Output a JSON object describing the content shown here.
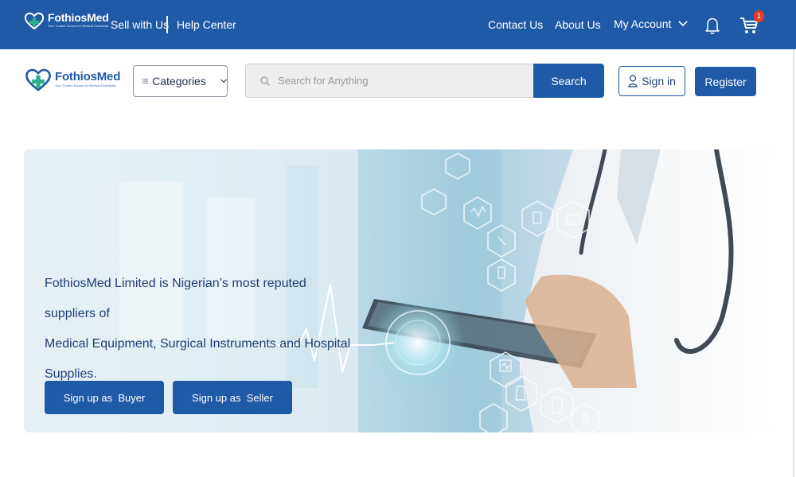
{
  "brand": {
    "name_part1": "Fothios",
    "name_part2": "Med",
    "tagline": "Your Trusted Source for Medical Essentials",
    "primary_color": "#1f5aa6",
    "accent_color": "#2bb08a",
    "logo_icon": "heart-cross-logo"
  },
  "topbar": {
    "sell_with_us": "Sell with Us",
    "help_center": "Help Center",
    "contact_us": "Contact Us",
    "about_us": "About Us",
    "my_account": "My Account",
    "cart_count": "1",
    "icons": [
      "chevron-down-icon",
      "bell-icon",
      "cart-icon"
    ]
  },
  "navbar": {
    "categories_label": "Categories",
    "search_placeholder": "Search for Anything",
    "search_button": "Search",
    "sign_in": "Sign in",
    "register": "Register",
    "icons": [
      "list-icon",
      "chevron-down-icon",
      "search-icon",
      "user-icon"
    ]
  },
  "hero": {
    "headline": "FothiosMed Limited is Nigerian’s most reputed suppliers of Medical Equipment, Surgical Instruments and Hospital Supplies.",
    "headline_lines": [
      "FothiosMed Limited is Nigerian’s most reputed suppliers of",
      "Medical Equipment, Surgical Instruments and Hospital",
      "Supplies."
    ],
    "buyer_button": "Sign up as  Buyer",
    "seller_button": "Sign up as  Seller"
  }
}
